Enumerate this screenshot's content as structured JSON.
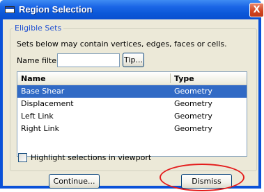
{
  "window": {
    "title": "Region Selection",
    "close_glyph": "X"
  },
  "group": {
    "label": "Eligible Sets",
    "description": "Sets below may contain vertices, edges, faces or cells."
  },
  "filter": {
    "label": "Name filter:",
    "value": "",
    "tip_label": "Tip..."
  },
  "table": {
    "columns": [
      "Name",
      "Type"
    ],
    "rows": [
      {
        "name": "Base Shear",
        "type": "Geometry",
        "selected": true
      },
      {
        "name": "Displacement",
        "type": "Geometry",
        "selected": false
      },
      {
        "name": "Left Link",
        "type": "Geometry",
        "selected": false
      },
      {
        "name": "Right Link",
        "type": "Geometry",
        "selected": false
      }
    ]
  },
  "options": {
    "highlight_label": "Highlight selections in viewport",
    "highlight_checked": false
  },
  "buttons": {
    "continue_label": "Continue...",
    "dismiss_label": "Dismiss"
  },
  "annotation": {
    "highlight_color": "#e41c1c",
    "target": "dismiss-button"
  },
  "colors": {
    "titlebar": "#0b57d8",
    "selection": "#316ac5",
    "group_label": "#1f4fd1",
    "dialog_bg": "#ece9d8"
  }
}
